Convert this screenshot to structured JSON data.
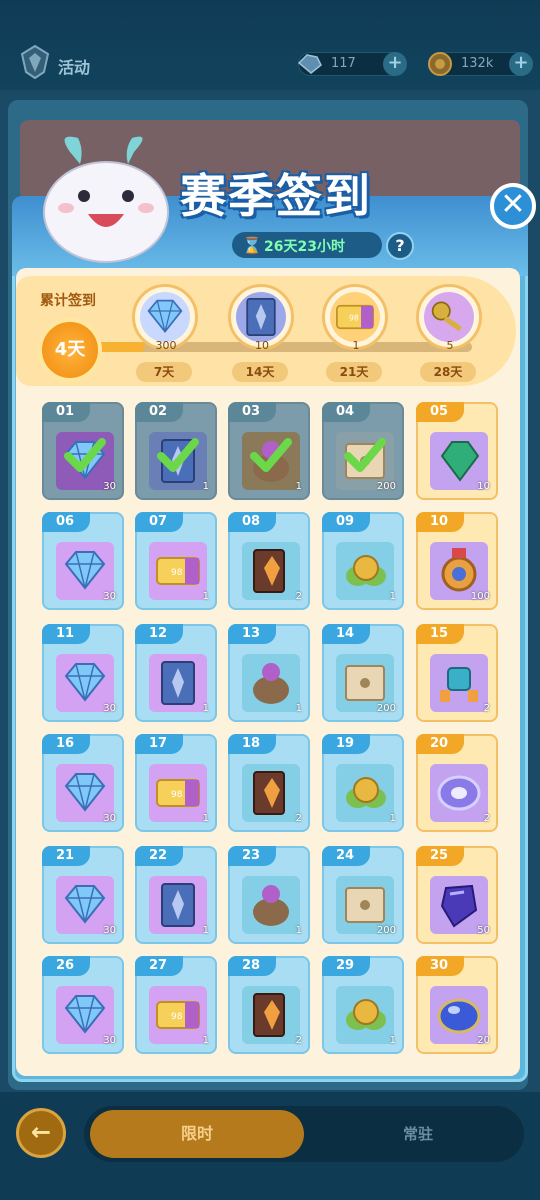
{
  "topbar": {
    "page_label": "活动",
    "resource1": "117",
    "resource2": "132k",
    "plus": "+"
  },
  "event": {
    "title": "赛季签到",
    "timer": "26天23小时",
    "help": "?",
    "close": "✕"
  },
  "cumulative": {
    "label": "累计签到",
    "count_text": "4天",
    "progress_fraction": 0.13,
    "milestones": [
      {
        "qty": "300",
        "day": "7天",
        "color": "#c9d8ff",
        "icon": "crystal"
      },
      {
        "qty": "10",
        "day": "14天",
        "color": "#9da8e8",
        "icon": "card"
      },
      {
        "qty": "1",
        "day": "21天",
        "color": "#ffd27a",
        "icon": "ticket"
      },
      {
        "qty": "5",
        "day": "28天",
        "color": "#d8a8ef",
        "icon": "key"
      }
    ]
  },
  "days": [
    {
      "n": "01",
      "qty": "30",
      "state": "done",
      "color": "#8e5bb8",
      "icon": "crystal"
    },
    {
      "n": "02",
      "qty": "1",
      "state": "done",
      "color": "#6a7fb6",
      "icon": "card"
    },
    {
      "n": "03",
      "qty": "1",
      "state": "done",
      "color": "#8a7a5a",
      "icon": "bag"
    },
    {
      "n": "04",
      "qty": "200",
      "state": "done",
      "color": "#8aa0a8",
      "icon": "scroll"
    },
    {
      "n": "05",
      "qty": "10",
      "state": "gold",
      "color": "#c3a3f0",
      "icon": "emerald"
    },
    {
      "n": "06",
      "qty": "30",
      "state": "normal",
      "color": "#d3a2f2",
      "icon": "crystal"
    },
    {
      "n": "07",
      "qty": "1",
      "state": "normal",
      "color": "#d3a2f2",
      "icon": "ticket"
    },
    {
      "n": "08",
      "qty": "2",
      "state": "normal",
      "color": "#84cfe6",
      "icon": "book"
    },
    {
      "n": "09",
      "qty": "1",
      "state": "normal",
      "color": "#84cfe6",
      "icon": "coin"
    },
    {
      "n": "10",
      "qty": "100",
      "state": "gold",
      "color": "#c3a3f0",
      "icon": "medal"
    },
    {
      "n": "11",
      "qty": "30",
      "state": "normal",
      "color": "#d3a2f2",
      "icon": "crystal"
    },
    {
      "n": "12",
      "qty": "1",
      "state": "normal",
      "color": "#d3a2f2",
      "icon": "card"
    },
    {
      "n": "13",
      "qty": "1",
      "state": "normal",
      "color": "#84cfe6",
      "icon": "bag"
    },
    {
      "n": "14",
      "qty": "200",
      "state": "normal",
      "color": "#84cfe6",
      "icon": "scroll"
    },
    {
      "n": "15",
      "qty": "2",
      "state": "gold",
      "color": "#c3a3f0",
      "icon": "robot"
    },
    {
      "n": "16",
      "qty": "30",
      "state": "normal",
      "color": "#d3a2f2",
      "icon": "crystal"
    },
    {
      "n": "17",
      "qty": "1",
      "state": "normal",
      "color": "#d3a2f2",
      "icon": "ticket"
    },
    {
      "n": "18",
      "qty": "2",
      "state": "normal",
      "color": "#84cfe6",
      "icon": "book"
    },
    {
      "n": "19",
      "qty": "1",
      "state": "normal",
      "color": "#84cfe6",
      "icon": "coin"
    },
    {
      "n": "20",
      "qty": "2",
      "state": "gold",
      "color": "#c3a3f0",
      "icon": "portal"
    },
    {
      "n": "21",
      "qty": "30",
      "state": "normal",
      "color": "#d3a2f2",
      "icon": "crystal"
    },
    {
      "n": "22",
      "qty": "1",
      "state": "normal",
      "color": "#d3a2f2",
      "icon": "card"
    },
    {
      "n": "23",
      "qty": "1",
      "state": "normal",
      "color": "#84cfe6",
      "icon": "bag"
    },
    {
      "n": "24",
      "qty": "200",
      "state": "normal",
      "color": "#84cfe6",
      "icon": "scroll"
    },
    {
      "n": "25",
      "qty": "50",
      "state": "gold",
      "color": "#c3a3f0",
      "icon": "gem"
    },
    {
      "n": "26",
      "qty": "30",
      "state": "normal",
      "color": "#d3a2f2",
      "icon": "crystal"
    },
    {
      "n": "27",
      "qty": "1",
      "state": "normal",
      "color": "#d3a2f2",
      "icon": "ticket"
    },
    {
      "n": "28",
      "qty": "2",
      "state": "normal",
      "color": "#84cfe6",
      "icon": "book"
    },
    {
      "n": "29",
      "qty": "1",
      "state": "normal",
      "color": "#84cfe6",
      "icon": "coin"
    },
    {
      "n": "30",
      "qty": "20",
      "state": "gold",
      "color": "#c3a3f0",
      "icon": "orb"
    }
  ],
  "footer": {
    "back": "←",
    "tab_active": "限时",
    "tab_other": "常驻"
  }
}
